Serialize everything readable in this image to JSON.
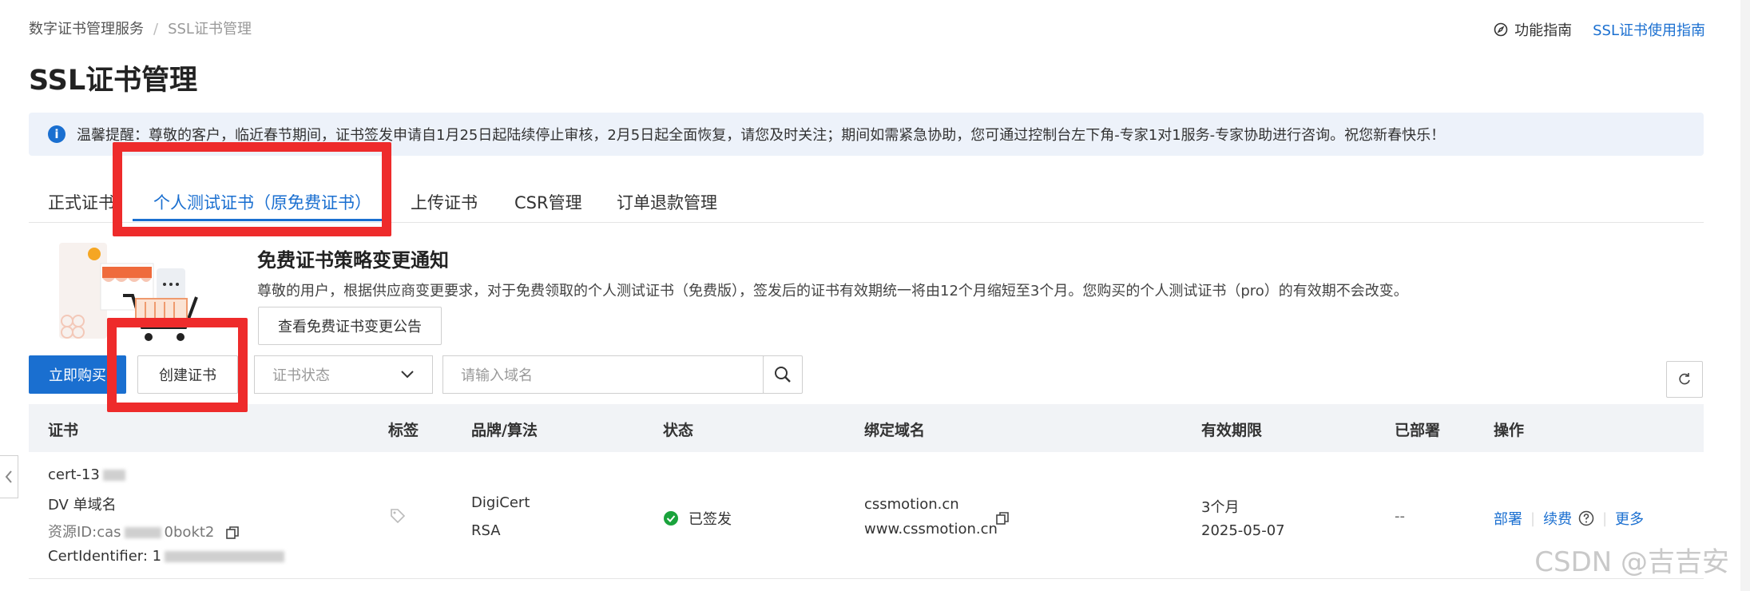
{
  "breadcrumb": {
    "root": "数字证书管理服务",
    "separator": "/",
    "current": "SSL证书管理"
  },
  "header": {
    "guide_label": "功能指南",
    "usage_link": "SSL证书使用指南",
    "title": "SSL证书管理"
  },
  "notice": {
    "text": "温馨提醒：尊敬的客户，临近春节期间，证书签发申请自1月25日起陆续停止审核，2月5日起全面恢复，请您及时关注；期间如需紧急协助，您可通过控制台左下角-专家1对1服务-专家协助进行咨询。祝您新春快乐！"
  },
  "tabs": [
    {
      "label": "正式证书"
    },
    {
      "label": "个人测试证书（原免费证书）"
    },
    {
      "label": "上传证书"
    },
    {
      "label": "CSR管理"
    },
    {
      "label": "订单退款管理"
    }
  ],
  "promo": {
    "title": "免费证书策略变更通知",
    "description": "尊敬的用户，根据供应商变更要求，对于免费领取的个人测试证书（免费版），签发后的证书有效期统一将由12个月缩短至3个月。您购买的个人测试证书（pro）的有效期不会改变。",
    "button": "查看免费证书变更公告"
  },
  "toolbar": {
    "buy_button": "立即购买",
    "create_button": "创建证书",
    "status_placeholder": "证书状态",
    "search_placeholder": "请输入域名"
  },
  "table": {
    "headers": [
      "证书",
      "标签",
      "品牌/算法",
      "状态",
      "绑定域名",
      "有效期限",
      "已部署",
      "操作"
    ],
    "rows": [
      {
        "cert_name": "cert-13",
        "cert_type": "DV 单域名",
        "resource_prefix": "资源ID:cas",
        "resource_suffix": "0bokt2",
        "identifier_prefix": "CertIdentifier: 1",
        "brand": "DigiCert",
        "algorithm": "RSA",
        "status": "已签发",
        "domains": [
          "cssmotion.cn",
          "www.cssmotion.cn"
        ],
        "validity": "3个月",
        "expiry": "2025-05-07",
        "deployed": "--",
        "actions": {
          "deploy": "部署",
          "renew": "续费",
          "more": "更多"
        }
      }
    ]
  },
  "watermark": "CSDN @吉吉安",
  "colors": {
    "accent": "#1a6fd0",
    "highlight_box": "#ee2b2b",
    "status_success": "#1aa33c",
    "notice_bg": "#edf2fa"
  }
}
